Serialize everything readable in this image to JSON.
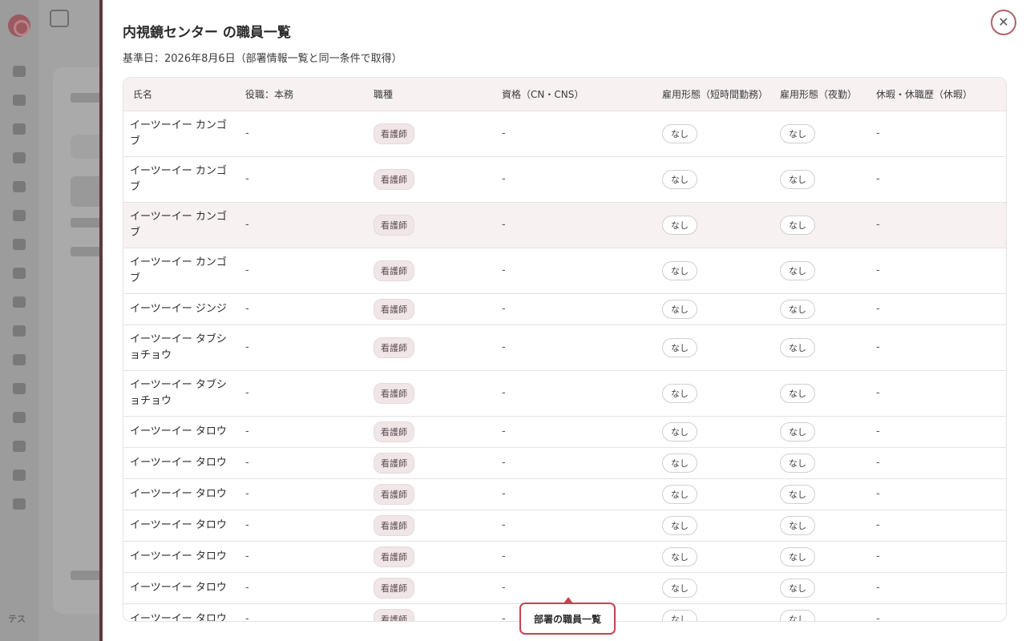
{
  "drawer": {
    "title": "内視鏡センター の職員一覧",
    "subtitle": "基準日：2026年8月6日（部署情報一覧と同一条件で取得）",
    "close_icon": "close-icon"
  },
  "table": {
    "headers": [
      "氏名",
      "役職：本務",
      "職種",
      "資格（CN・CNS）",
      "雇用形態（短時間勤務）",
      "雇用形態（夜勤）",
      "休暇・休職歴（休暇）"
    ],
    "rows": [
      {
        "name": "イーツーイー カンゴブ",
        "position": "-",
        "job": "看護師",
        "qual": "-",
        "short": "なし",
        "night": "なし",
        "leave": "-"
      },
      {
        "name": "イーツーイー カンゴブ",
        "position": "-",
        "job": "看護師",
        "qual": "-",
        "short": "なし",
        "night": "なし",
        "leave": "-"
      },
      {
        "name": "イーツーイー カンゴブ",
        "position": "-",
        "job": "看護師",
        "qual": "-",
        "short": "なし",
        "night": "なし",
        "leave": "-"
      },
      {
        "name": "イーツーイー カンゴブ",
        "position": "-",
        "job": "看護師",
        "qual": "-",
        "short": "なし",
        "night": "なし",
        "leave": "-"
      },
      {
        "name": "イーツーイー ジンジ",
        "position": "-",
        "job": "看護師",
        "qual": "-",
        "short": "なし",
        "night": "なし",
        "leave": "-"
      },
      {
        "name": "イーツーイー タブショチョウ",
        "position": "-",
        "job": "看護師",
        "qual": "-",
        "short": "なし",
        "night": "なし",
        "leave": "-"
      },
      {
        "name": "イーツーイー タブショチョウ",
        "position": "-",
        "job": "看護師",
        "qual": "-",
        "short": "なし",
        "night": "なし",
        "leave": "-"
      },
      {
        "name": "イーツーイー タロウ",
        "position": "-",
        "job": "看護師",
        "qual": "-",
        "short": "なし",
        "night": "なし",
        "leave": "-"
      },
      {
        "name": "イーツーイー タロウ",
        "position": "-",
        "job": "看護師",
        "qual": "-",
        "short": "なし",
        "night": "なし",
        "leave": "-"
      },
      {
        "name": "イーツーイー タロウ",
        "position": "-",
        "job": "看護師",
        "qual": "-",
        "short": "なし",
        "night": "なし",
        "leave": "-"
      },
      {
        "name": "イーツーイー タロウ",
        "position": "-",
        "job": "看護師",
        "qual": "-",
        "short": "なし",
        "night": "なし",
        "leave": "-"
      },
      {
        "name": "イーツーイー タロウ",
        "position": "-",
        "job": "看護師",
        "qual": "-",
        "short": "なし",
        "night": "なし",
        "leave": "-"
      },
      {
        "name": "イーツーイー タロウ",
        "position": "-",
        "job": "看護師",
        "qual": "-",
        "short": "なし",
        "night": "なし",
        "leave": "-"
      },
      {
        "name": "イーツーイー タロウ",
        "position": "-",
        "job": "看護師",
        "qual": "-",
        "short": "なし",
        "night": "なし",
        "leave": "-"
      }
    ]
  },
  "tooltip": {
    "label": "部署の職員一覧"
  },
  "background": {
    "avatar_initials": "テス"
  },
  "colors": {
    "accent": "#c9414f",
    "header_bg": "#f7f1f2",
    "badge_bg": "#f1e6e7"
  }
}
